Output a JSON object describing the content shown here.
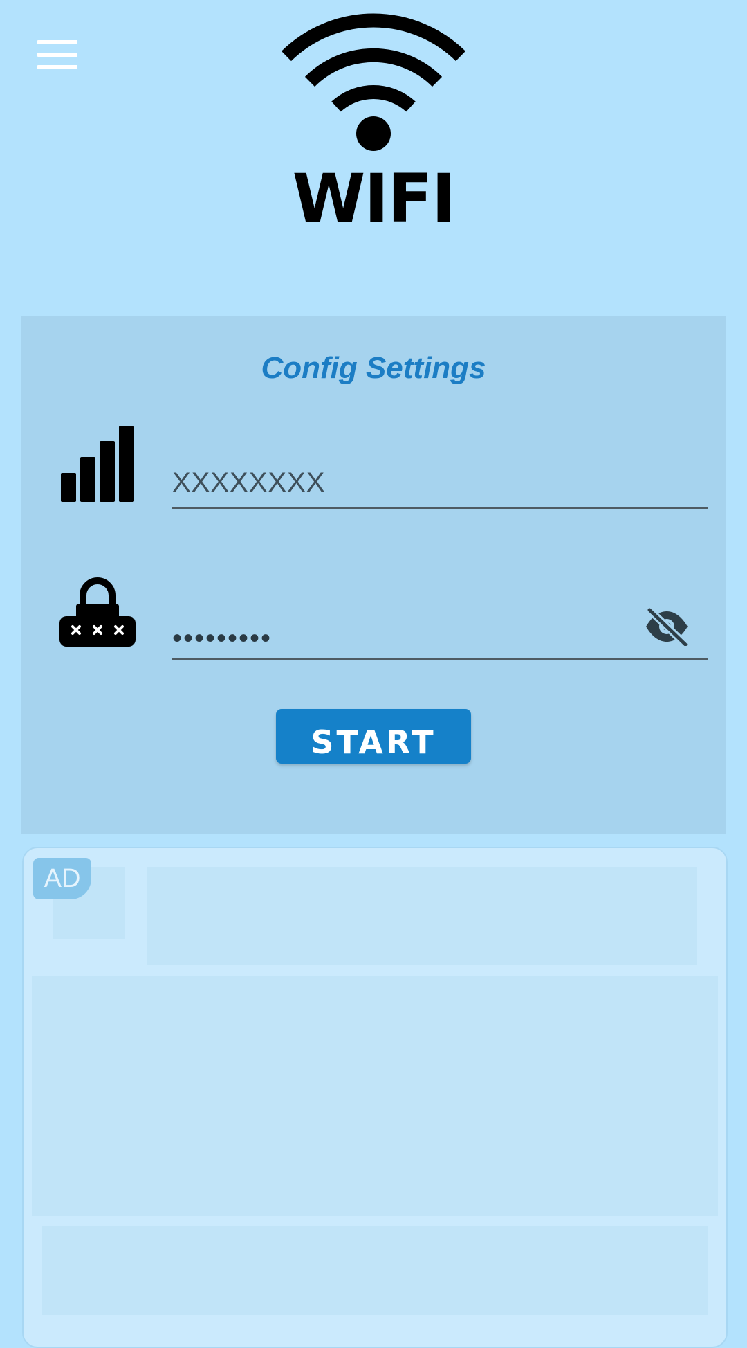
{
  "header": {
    "menu_icon": "hamburger-menu-icon",
    "logo_text": "WIFI",
    "logo_icon": "wifi-signal-icon"
  },
  "config": {
    "title": "Config Settings",
    "ssid": {
      "icon": "signal-bars-icon",
      "value": "XXXXXXXX"
    },
    "password": {
      "icon": "password-lock-icon",
      "value": "•••••••••",
      "visibility_icon": "eye-off-icon"
    },
    "start_label": "START"
  },
  "ad": {
    "badge": "AD"
  },
  "colors": {
    "background": "#b3e2fd",
    "panel": "#a6d3ee",
    "accent": "#1581c9",
    "title": "#1c7dc4"
  }
}
